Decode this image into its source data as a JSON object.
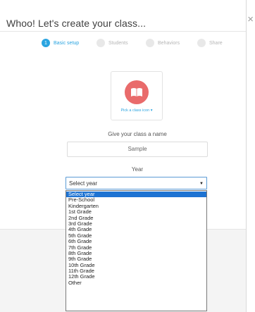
{
  "dialog": {
    "title": "Whoo! Let's create your class...",
    "close_glyph": "×"
  },
  "steps": [
    {
      "label": "Basic setup",
      "number": "1",
      "active": true
    },
    {
      "label": "Students",
      "number": "",
      "active": false
    },
    {
      "label": "Behaviors",
      "number": "",
      "active": false
    },
    {
      "label": "Share",
      "number": "",
      "active": false
    }
  ],
  "icon_picker": {
    "icon": "book-icon",
    "label": "Pick a class icon ▾",
    "color": "#e96b6b"
  },
  "name_field": {
    "label": "Give your class a name",
    "value": "Sample"
  },
  "year_field": {
    "label": "Year",
    "value": "Select year",
    "options": [
      "Select year",
      "Pre-School",
      "Kindergarten",
      "1st Grade",
      "2nd Grade",
      "3rd Grade",
      "4th Grade",
      "5th Grade",
      "6th Grade",
      "7th Grade",
      "8th Grade",
      "9th Grade",
      "10th Grade",
      "11th Grade",
      "12th Grade",
      "Other"
    ]
  },
  "colors": {
    "accent": "#2aa4e0",
    "selection": "#1e73d2"
  }
}
